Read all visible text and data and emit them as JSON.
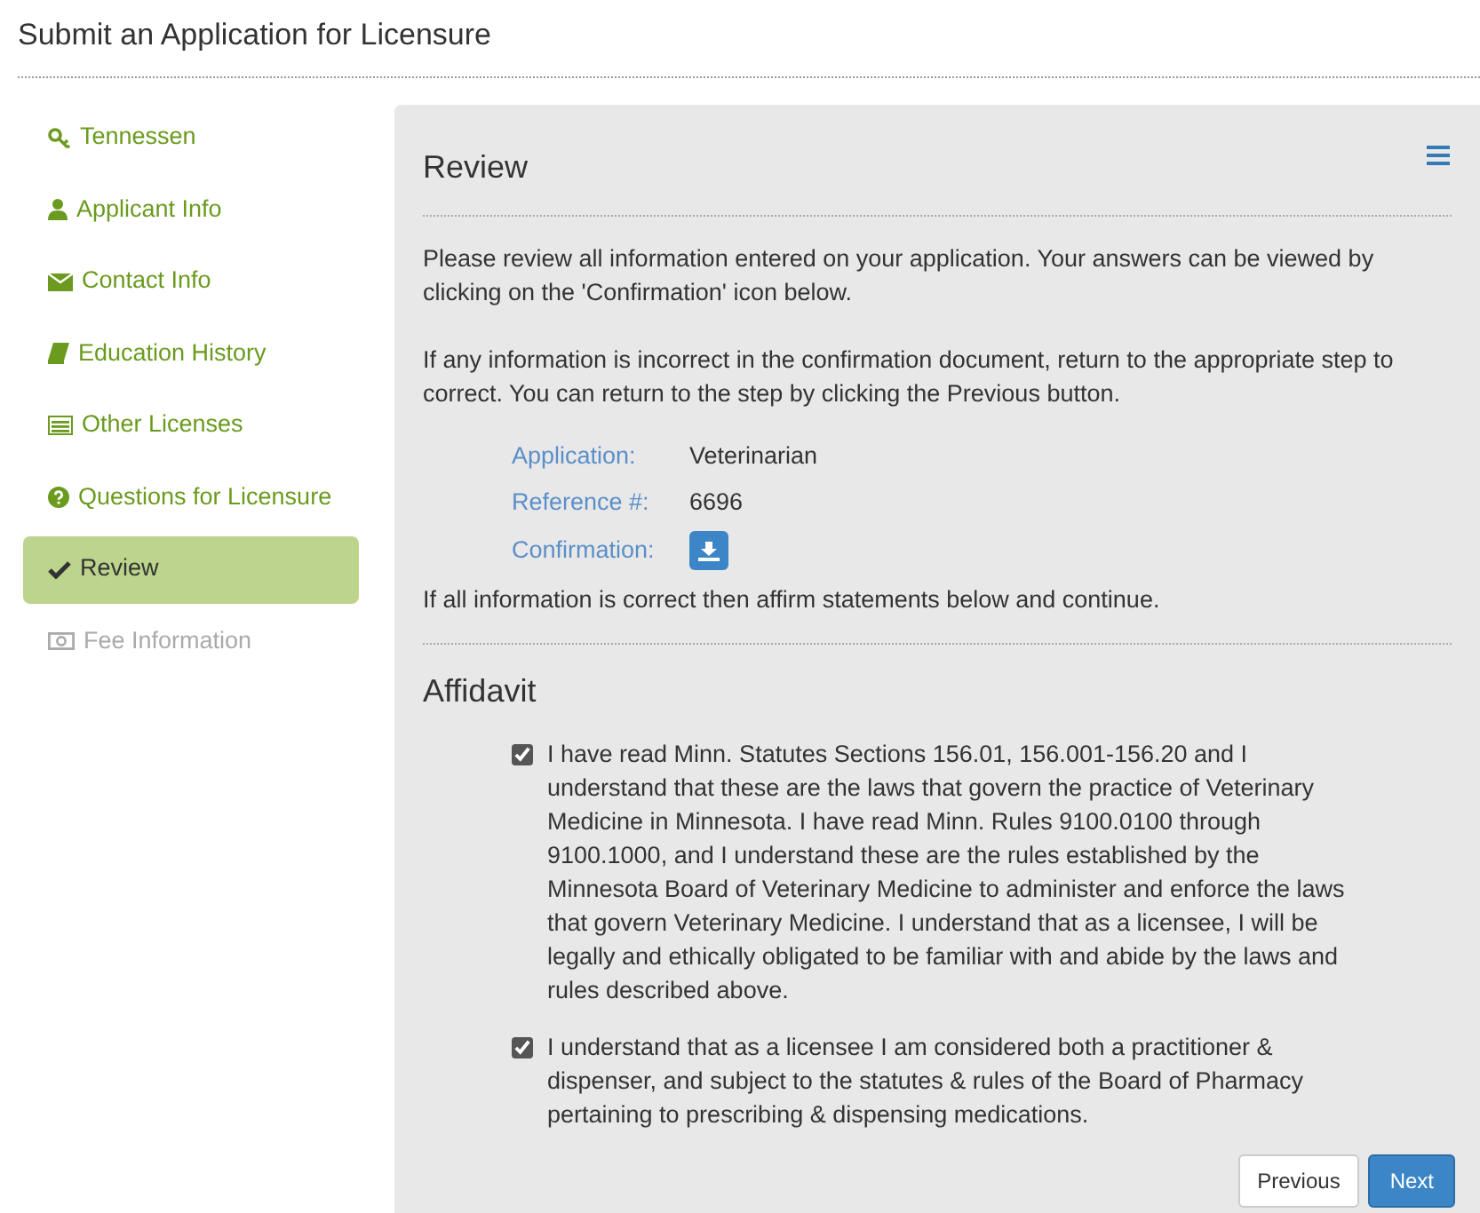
{
  "page_title": "Submit an Application for Licensure",
  "steps": [
    {
      "label": "Tennessen",
      "selected": false,
      "disabled": false
    },
    {
      "label": "Applicant Info",
      "selected": false,
      "disabled": false
    },
    {
      "label": "Contact Info",
      "selected": false,
      "disabled": false
    },
    {
      "label": "Education History",
      "selected": false,
      "disabled": false
    },
    {
      "label": "Other Licenses",
      "selected": false,
      "disabled": false
    },
    {
      "label": "Questions for Licensure",
      "selected": false,
      "disabled": false
    },
    {
      "label": "Review",
      "selected": true,
      "disabled": false
    },
    {
      "label": "Fee Information",
      "selected": false,
      "disabled": true
    }
  ],
  "panel": {
    "title": "Review",
    "paragraphs": [
      "Please review all information entered on your application. Your answers can be viewed by clicking on the 'Confirmation' icon below.",
      "If any information is incorrect in the confirmation document, return to the appropriate step to correct. You can return to the step by clicking the Previous button."
    ],
    "details": [
      {
        "kind": "text",
        "label": "Application:",
        "value": "Veterinarian"
      },
      {
        "kind": "text",
        "label": "Reference #:",
        "value": "6696"
      },
      {
        "kind": "download",
        "label": "Confirmation:"
      }
    ],
    "closing": "If all information is correct then affirm statements below and continue.",
    "affidavit_title": "Affidavit",
    "statements": [
      {
        "text": "I have read Minn. Statutes Sections 156.01, 156.001-156.20 and I understand that these are the laws that govern the practice of Veterinary Medicine in Minnesota. I have read Minn. Rules 9100.0100 through 9100.1000, and I understand these are the rules established by the Minnesota Board of Veterinary Medicine to administer and enforce the laws that govern Veterinary Medicine. I understand that as a licensee, I will be legally and ethically obligated to be familiar with and abide by the laws and rules described above.",
        "checked": true
      },
      {
        "text": "I understand that as a licensee I am considered both a practitioner & dispenser, and subject to the statutes & rules of the Board of Pharmacy pertaining to prescribing & dispensing medications.",
        "checked": true
      }
    ],
    "buttons": [
      "Previous",
      "Next"
    ]
  }
}
